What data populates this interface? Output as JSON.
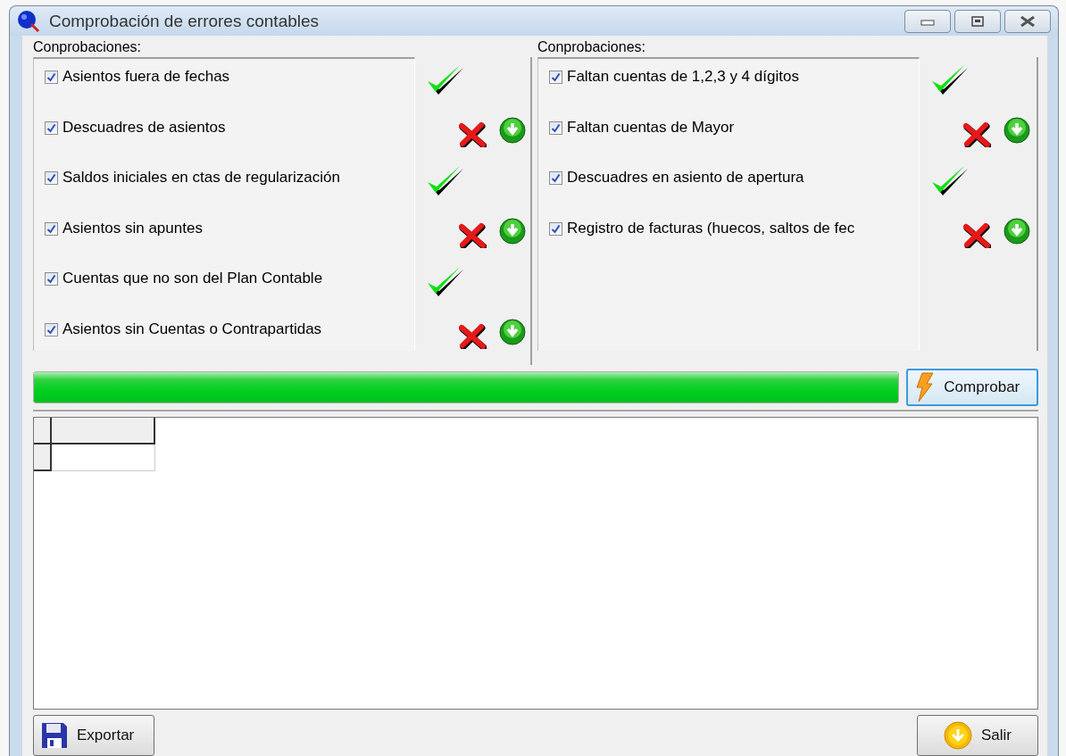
{
  "window": {
    "title": "Comprobación de errores contables"
  },
  "groups": [
    {
      "label": "Conprobaciones:",
      "checks": [
        {
          "label": "Asientos fuera de fechas",
          "checked": true,
          "passed": true
        },
        {
          "label": "Descuadres de asientos",
          "checked": true,
          "passed": false
        },
        {
          "label": "Saldos iniciales en ctas de regularización",
          "checked": true,
          "passed": true
        },
        {
          "label": "Asientos sin apuntes",
          "checked": true,
          "passed": false
        },
        {
          "label": "Cuentas que no son del Plan Contable",
          "checked": true,
          "passed": true
        },
        {
          "label": "Asientos sin Cuentas o Contrapartidas",
          "checked": true,
          "passed": false
        }
      ]
    },
    {
      "label": "Conprobaciones:",
      "checks": [
        {
          "label": "Faltan cuentas de 1,2,3 y 4 dígitos",
          "checked": true,
          "passed": true
        },
        {
          "label": "Faltan cuentas de Mayor",
          "checked": true,
          "passed": false
        },
        {
          "label": "Descuadres en asiento de apertura",
          "checked": true,
          "passed": true
        },
        {
          "label": "Registro de facturas (huecos, saltos de fec",
          "checked": true,
          "passed": false
        }
      ]
    }
  ],
  "progress": {
    "level": 1
  },
  "check_button": "Comprobar",
  "export_button": "Exportar",
  "exit_button": "Salir"
}
